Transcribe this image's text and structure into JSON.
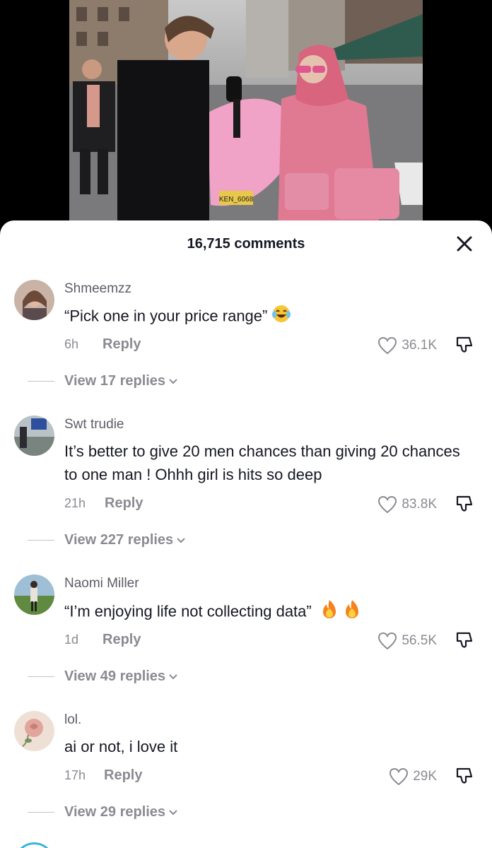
{
  "video": {
    "plate_text": "KEN_6068"
  },
  "sheet": {
    "comment_count": "16,715 comments"
  },
  "comments": [
    {
      "username": "Shmeemzz",
      "text": "“Pick one in your price range”",
      "emojis": [
        "laughing-tears"
      ],
      "time": "6h",
      "reply_label": "Reply",
      "likes": "36.1K",
      "view_replies": "View 17 replies"
    },
    {
      "username": "Swt trudie",
      "text": "It’s better to give 20 men chances than giving 20 chances to one man ! Ohhh girl is hits so deep",
      "emojis": [],
      "time": "21h",
      "reply_label": "Reply",
      "likes": "83.8K",
      "view_replies": "View 227 replies"
    },
    {
      "username": "Naomi Miller",
      "text": "“I’m enjoying life not collecting data”",
      "emojis": [
        "fire",
        "fire"
      ],
      "time": "1d",
      "reply_label": "Reply",
      "likes": "56.5K",
      "view_replies": "View 49 replies"
    },
    {
      "username": "lol.",
      "text": "ai or not, i love it",
      "emojis": [],
      "time": "17h",
      "reply_label": "Reply",
      "likes": "29K",
      "view_replies": "View 29 replies"
    }
  ],
  "colors": {
    "primary_text": "#161823",
    "secondary_text": "#8a8b91",
    "sheet_bg": "#ffffff",
    "video_bg": "#000000"
  }
}
